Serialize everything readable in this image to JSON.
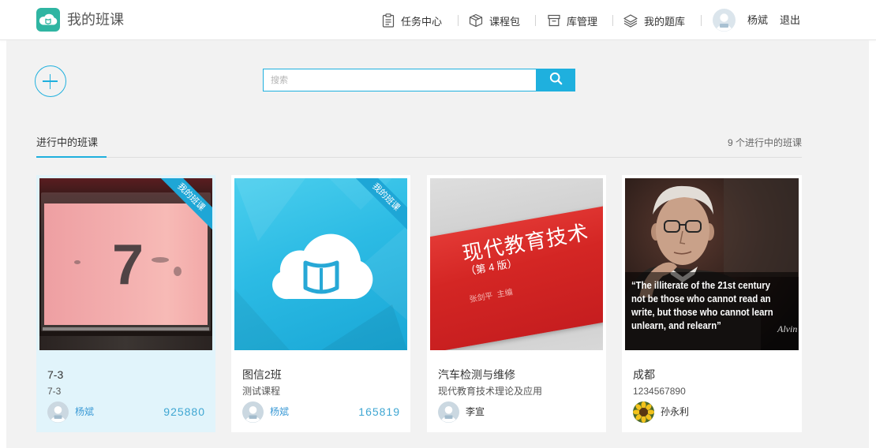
{
  "app": {
    "title": "我的班课",
    "logo_icon": "cloud-book-logo-icon"
  },
  "nav": [
    {
      "label": "任务中心",
      "icon": "clipboard-icon"
    },
    {
      "label": "课程包",
      "icon": "package-icon"
    },
    {
      "label": "库管理",
      "icon": "archive-icon"
    },
    {
      "label": "我的题库",
      "icon": "layers-icon"
    }
  ],
  "user": {
    "name": "杨斌",
    "logout": "退出",
    "avatar_icon": "default-avatar-icon"
  },
  "toolbar": {
    "add_icon": "plus-circle-icon"
  },
  "search": {
    "placeholder": "搜索",
    "button_icon": "search-icon"
  },
  "section": {
    "title": "进行中的班课",
    "count_text": "9 个进行中的班课"
  },
  "classes": [
    {
      "title": "7-3",
      "subtitle": "7-3",
      "teacher": "杨斌",
      "code": "925880",
      "ribbon": "我的班课",
      "avatar_icon": "default-avatar-icon",
      "cover": {
        "text": "7"
      }
    },
    {
      "title": "图信2班",
      "subtitle": "测试课程",
      "teacher": "杨斌",
      "code": "165819",
      "ribbon": "我的班课",
      "avatar_icon": "default-avatar-icon",
      "cover": {
        "icon": "cloud-book-icon"
      }
    },
    {
      "title": "汽车检测与维修",
      "subtitle": "现代教育技术理论及应用",
      "teacher": "李宣",
      "avatar_icon": "default-avatar-icon",
      "cover": {
        "book_title": "现代教育技术",
        "edition": "（第 4 版）",
        "author": "张剑平  主编"
      }
    },
    {
      "title": "成都",
      "subtitle": "1234567890",
      "teacher": "孙永利",
      "avatar_icon": "sunflower-avatar-icon",
      "cover": {
        "quote_lines": [
          "“The illiterate of the 21st century",
          "not be those who cannot read an",
          "write, but those who cannot learn",
          "unlearn, and relearn”"
        ],
        "signature": "Alvin"
      }
    }
  ],
  "colors": {
    "accent": "#1fb0de",
    "ribbon": "#1ea6d6",
    "selected_card_bg": "#e1f4fb",
    "page_bg": "#f2f2f2",
    "logo": "#2fb5a2"
  }
}
